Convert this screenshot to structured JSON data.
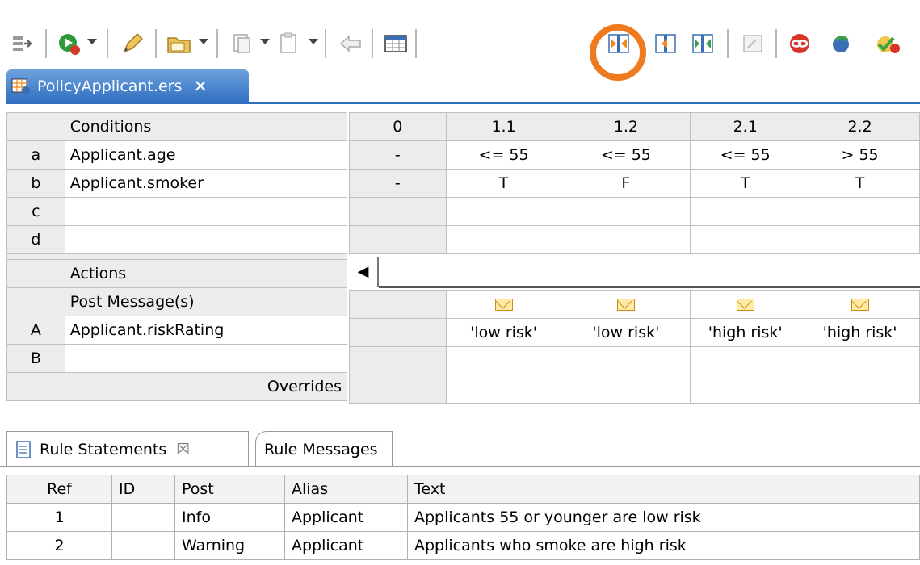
{
  "toolbar": {
    "icons": [
      "insert-column-icon",
      "run-test-icon",
      "edit-pencil-icon",
      "open-folder-icon",
      "copy-rule-icon",
      "paste-rule-icon",
      "back-arrow-icon",
      "table-view-icon",
      "expand-columns-icon",
      "collapse-column-icon",
      "split-columns-icon",
      "disabled-edit-icon",
      "link-icon",
      "sync-icon",
      "validate-icon"
    ],
    "highlight_color": "#f07a1e"
  },
  "editor": {
    "tab_title": "PolicyApplicant.ers",
    "tab_close": "✕",
    "conditions_header": "Conditions",
    "condition_rows": [
      {
        "letter": "a",
        "name": "Applicant.age"
      },
      {
        "letter": "b",
        "name": "Applicant.smoker"
      },
      {
        "letter": "c",
        "name": ""
      },
      {
        "letter": "d",
        "name": ""
      }
    ],
    "actions_header": "Actions",
    "post_message_header": "Post Message(s)",
    "action_rows": [
      {
        "letter": "A",
        "name": "Applicant.riskRating"
      },
      {
        "letter": "B",
        "name": ""
      }
    ],
    "overrides_label": "Overrides",
    "columns": [
      "0",
      "1.1",
      "1.2",
      "2.1",
      "2.2"
    ],
    "condition_values": [
      [
        "-",
        "<= 55",
        "<= 55",
        "<= 55",
        "> 55"
      ],
      [
        "-",
        "T",
        "F",
        "T",
        "T"
      ],
      [
        "",
        "",
        "",
        "",
        ""
      ],
      [
        "",
        "",
        "",
        "",
        ""
      ]
    ],
    "scroll_left_glyph": "◀",
    "action_values": [
      [
        "",
        "'low risk'",
        "'low risk'",
        "'high risk'",
        "'high risk'"
      ],
      [
        "",
        "",
        "",
        "",
        ""
      ]
    ]
  },
  "bottom_panel": {
    "tab_rule_statements": "Rule Statements",
    "tab_close_glyph": "☒",
    "tab_rule_messages": "Rule Messages",
    "headers": [
      "Ref",
      "ID",
      "Post",
      "Alias",
      "Text"
    ],
    "rows": [
      [
        "1",
        "",
        "Info",
        "Applicant",
        "Applicants 55 or younger are low risk"
      ],
      [
        "2",
        "",
        "Warning",
        "Applicant",
        "Applicants who smoke are high risk"
      ]
    ]
  }
}
